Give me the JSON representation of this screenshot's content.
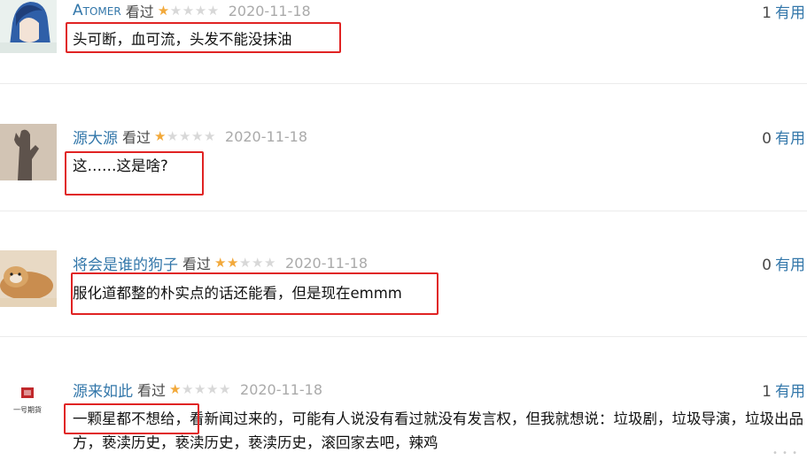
{
  "reviews": [
    {
      "username": "Atomer",
      "watched": "看过",
      "rating": 1,
      "date": "2020-11-18",
      "votes": "1",
      "useful_label": "有用",
      "content": "头可断，血可流，头发不能没抹油"
    },
    {
      "username": "源大源",
      "watched": "看过",
      "rating": 1,
      "date": "2020-11-18",
      "votes": "0",
      "useful_label": "有用",
      "content": "这……这是啥?"
    },
    {
      "username": "将会是谁的狗子",
      "watched": "看过",
      "rating": 2,
      "date": "2020-11-18",
      "votes": "0",
      "useful_label": "有用",
      "content": "服化道都整的朴实点的话还能看，但是现在emmm"
    },
    {
      "username": "源来如此",
      "watched": "看过",
      "rating": 1,
      "date": "2020-11-18",
      "votes": "1",
      "useful_label": "有用",
      "content": "一颗星都不想给，看新闻过来的，可能有人说没有看过就没有发言权，但我就想说：垃圾剧，垃圾导演，垃圾出品方，亵渎历史，亵渎历史，亵渎历史，滚回家去吧，辣鸡",
      "avatar_text": "一号期貨"
    }
  ],
  "colors": {
    "username": "#3377aa",
    "star_on": "#f2a93b",
    "star_off": "#d8d8d8",
    "date": "#aaaaaa",
    "highlight_box": "#e02323"
  }
}
